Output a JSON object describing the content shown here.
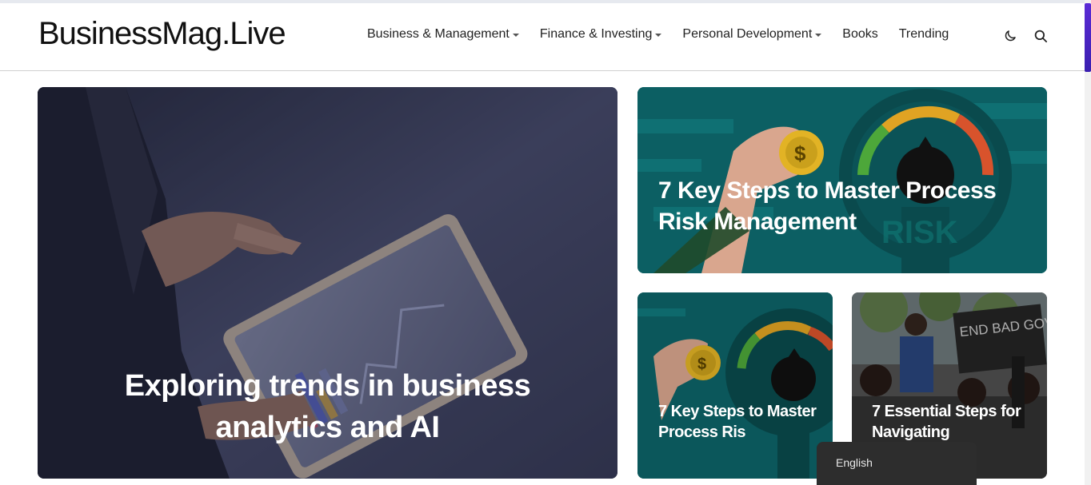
{
  "site": {
    "logo": "BusinessMag.Live"
  },
  "nav": {
    "items": [
      {
        "label": "Business & Management",
        "has_dropdown": true
      },
      {
        "label": "Finance & Investing",
        "has_dropdown": true
      },
      {
        "label": "Personal Development",
        "has_dropdown": true
      },
      {
        "label": "Books",
        "has_dropdown": false
      },
      {
        "label": "Trending",
        "has_dropdown": false
      }
    ],
    "icons": [
      "moon-icon",
      "search-icon"
    ]
  },
  "featured": {
    "main": {
      "title": "Exploring trends in business analytics and AI"
    },
    "top_right": {
      "title": "7 Key Steps to Master Process Risk Management"
    },
    "bottom_left": {
      "title": "7 Key Steps to Master Process Ris"
    },
    "bottom_right": {
      "title": "7 Essential Steps for Navigating"
    }
  },
  "sign_text": "END BAD GOVERNMENT",
  "coin_symbol": "$",
  "gauge_text": "RISK",
  "language_popup": {
    "label": "English"
  },
  "colors": {
    "accent": "#5b2bd6",
    "teal": "#0c5f63",
    "dark_overlay": "#2a2e46"
  }
}
